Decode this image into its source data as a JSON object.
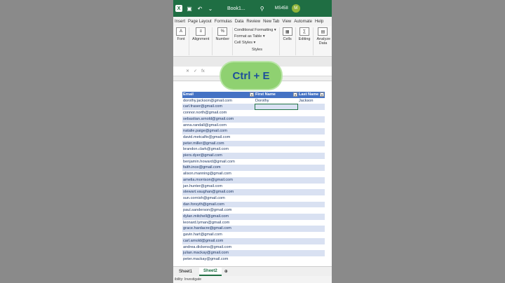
{
  "titlebar": {
    "app_logo": "X",
    "title": "Book1...",
    "user_code": "MS458",
    "avatar": "M"
  },
  "tabs": [
    "Insert",
    "Page Layout",
    "Formulas",
    "Data",
    "Review",
    "New Tab",
    "View",
    "Automate",
    "Help"
  ],
  "ribbon": {
    "font": "Font",
    "alignment": "Alignment",
    "number": "Number",
    "conditional": "Conditional Formatting ▾",
    "format_table": "Format as Table ▾",
    "cell_styles": "Cell Styles ▾",
    "styles": "Styles",
    "cells": "Cells",
    "editing": "Editing",
    "analyze": "Analyze Data"
  },
  "formula_bar": {
    "cancel": "✕",
    "enter": "✓",
    "fx": "fx"
  },
  "overlay": {
    "label": "Ctrl + E"
  },
  "table": {
    "headers": [
      "Email",
      "First Name",
      "Last Name"
    ],
    "rows": [
      [
        "dorothy.jackson@gmail.com",
        "Dorothy",
        "Jackson"
      ],
      [
        "carl.fraser@gmail.com",
        "",
        ""
      ],
      [
        "connor.north@gmail.com",
        "",
        ""
      ],
      [
        "sebastian.arnold@gmail.com",
        "",
        ""
      ],
      [
        "anna.randall@gmail.com",
        "",
        ""
      ],
      [
        "natalie.paige@gmail.com",
        "",
        ""
      ],
      [
        "david.metcalfe@gmail.com",
        "",
        ""
      ],
      [
        "peter.miller@gmail.com",
        "",
        ""
      ],
      [
        "brandon.clark@gmail.com",
        "",
        ""
      ],
      [
        "piers.dyer@gmail.com",
        "",
        ""
      ],
      [
        "benjamin.howard@gmail.com",
        "",
        ""
      ],
      [
        "faith.ince@gmail.com",
        "",
        ""
      ],
      [
        "alison.manning@gmail.com",
        "",
        ""
      ],
      [
        "amelia.morrison@gmail.com",
        "",
        ""
      ],
      [
        "jan.hunter@gmail.com",
        "",
        ""
      ],
      [
        "stewart.vaughan@gmail.com",
        "",
        ""
      ],
      [
        "sun.cornish@gmail.com",
        "",
        ""
      ],
      [
        "dan.forsyth@gmail.com",
        "",
        ""
      ],
      [
        "paul.sanderson@gmail.com",
        "",
        ""
      ],
      [
        "dylan.mitchell@gmail.com",
        "",
        ""
      ],
      [
        "leonard.lyman@gmail.com",
        "",
        ""
      ],
      [
        "grace.hardacre@gmail.com",
        "",
        ""
      ],
      [
        "gavin.hart@gmail.com",
        "",
        ""
      ],
      [
        "carl.arnold@gmail.com",
        "",
        ""
      ],
      [
        "andrea.dickens@gmail.com",
        "",
        ""
      ],
      [
        "julian.mackay@gmail.com",
        "",
        ""
      ],
      [
        "peter.mackay@gmail.com",
        "",
        ""
      ]
    ]
  },
  "sheets": [
    "Sheet1",
    "Sheet2"
  ],
  "status": {
    "text": "ibility: Investigate"
  },
  "colors": {
    "excel_green": "#1f6e43",
    "header_blue": "#4472c4",
    "band": "#d9e1f2"
  }
}
